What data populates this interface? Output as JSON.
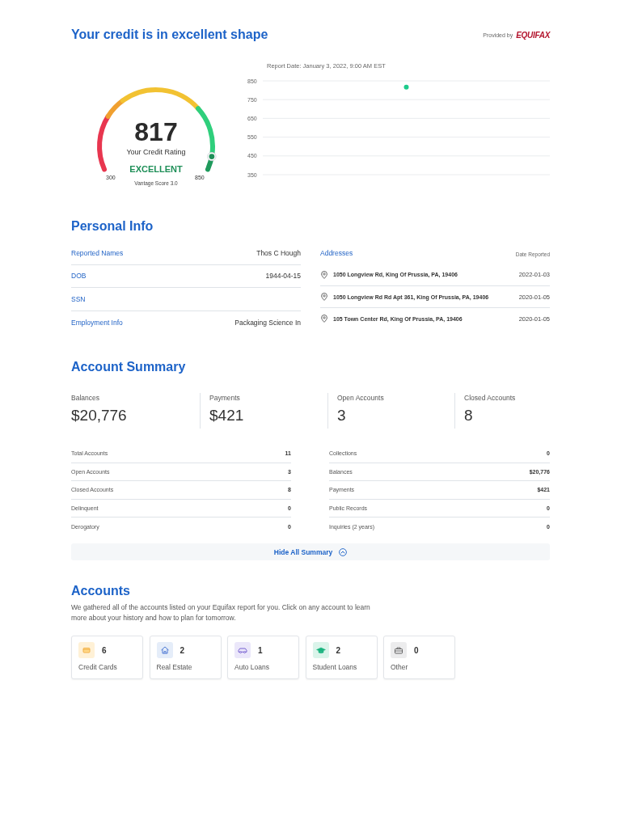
{
  "header": {
    "title": "Your credit is in excellent shape",
    "provided_by": "Provided by",
    "provider_logo": "EQUIFAX"
  },
  "score_gauge": {
    "score": "817",
    "caption": "Your Credit Rating",
    "rating": "EXCELLENT",
    "min_label": "300",
    "max_label": "850",
    "model": "Vantage Score 3.0",
    "level": 0.94
  },
  "score_history": {
    "chart_data": {
      "type": "scatter",
      "title": "Report Date: January 3, 2022, 9:00 AM EST",
      "ylim": [
        350,
        850
      ],
      "yticks": [
        350,
        450,
        550,
        650,
        750,
        850
      ],
      "grid": true,
      "series": [
        {
          "color": "#1ecb8c",
          "values": [
            817
          ]
        }
      ]
    }
  },
  "personal_info": {
    "title": "Personal Info",
    "details": [
      {
        "label": "Reported Names",
        "value": "Thos C Hough"
      },
      {
        "label": "DOB",
        "value": "1944-04-15"
      },
      {
        "label": "SSN"
      },
      {
        "label": "Employment Info",
        "value": "Packaging Science In"
      }
    ],
    "addresses": {
      "title": "Addresses",
      "date_header": "Date Reported",
      "rows": [
        {
          "address": "1050 Longview Rd, King Of Prussia, PA, 19406",
          "date": "2022-01-03"
        },
        {
          "address": "1050 Longview Rd Rd Apt 361, King Of Prussia, PA, 19406",
          "date": "2020-01-05"
        },
        {
          "address": "105 Town Center Rd, King Of Prussia, PA, 19406",
          "date": "2020-01-05"
        }
      ]
    }
  },
  "account_summary": {
    "title": "Account Summary",
    "stats": [
      {
        "label": "Balances",
        "value": "$20,776"
      },
      {
        "label": "Payments",
        "value": "$421"
      },
      {
        "label": "Open Accounts",
        "value": "3"
      },
      {
        "label": "Closed Accounts",
        "value": "8"
      }
    ],
    "details_left": [
      {
        "label": "Total Accounts",
        "value": "11"
      },
      {
        "label": "Open Accounts",
        "value": "3"
      },
      {
        "label": "Closed Accounts",
        "value": "8"
      },
      {
        "label": "Delinquent",
        "value": "0"
      },
      {
        "label": "Derogatory",
        "value": "0"
      }
    ],
    "details_right": [
      {
        "label": "Collections",
        "value": "0"
      },
      {
        "label": "Balances",
        "value": "$20,776"
      },
      {
        "label": "Payments",
        "value": "$421"
      },
      {
        "label": "Public Records",
        "value": "0"
      },
      {
        "label": "Inquiries (2 years)",
        "value": "0"
      }
    ],
    "summary_toggle": {
      "label": "Hide All Summary",
      "expanded": true
    }
  },
  "accounts": {
    "title": "Accounts",
    "description": "We gathered all of the accounts listed on your Equifax report for you. Click on any account to learn more about your history and how to plan for tomorrow.",
    "types": [
      {
        "kind": "credit_cards",
        "count": "6",
        "label": "Credit Cards"
      },
      {
        "kind": "real_estate",
        "count": "2",
        "label": "Real Estate"
      },
      {
        "kind": "auto_loans",
        "count": "1",
        "label": "Auto Loans"
      },
      {
        "kind": "student_loans",
        "count": "2",
        "label": "Student Loans"
      },
      {
        "kind": "other",
        "count": "0",
        "label": "Other"
      }
    ]
  }
}
